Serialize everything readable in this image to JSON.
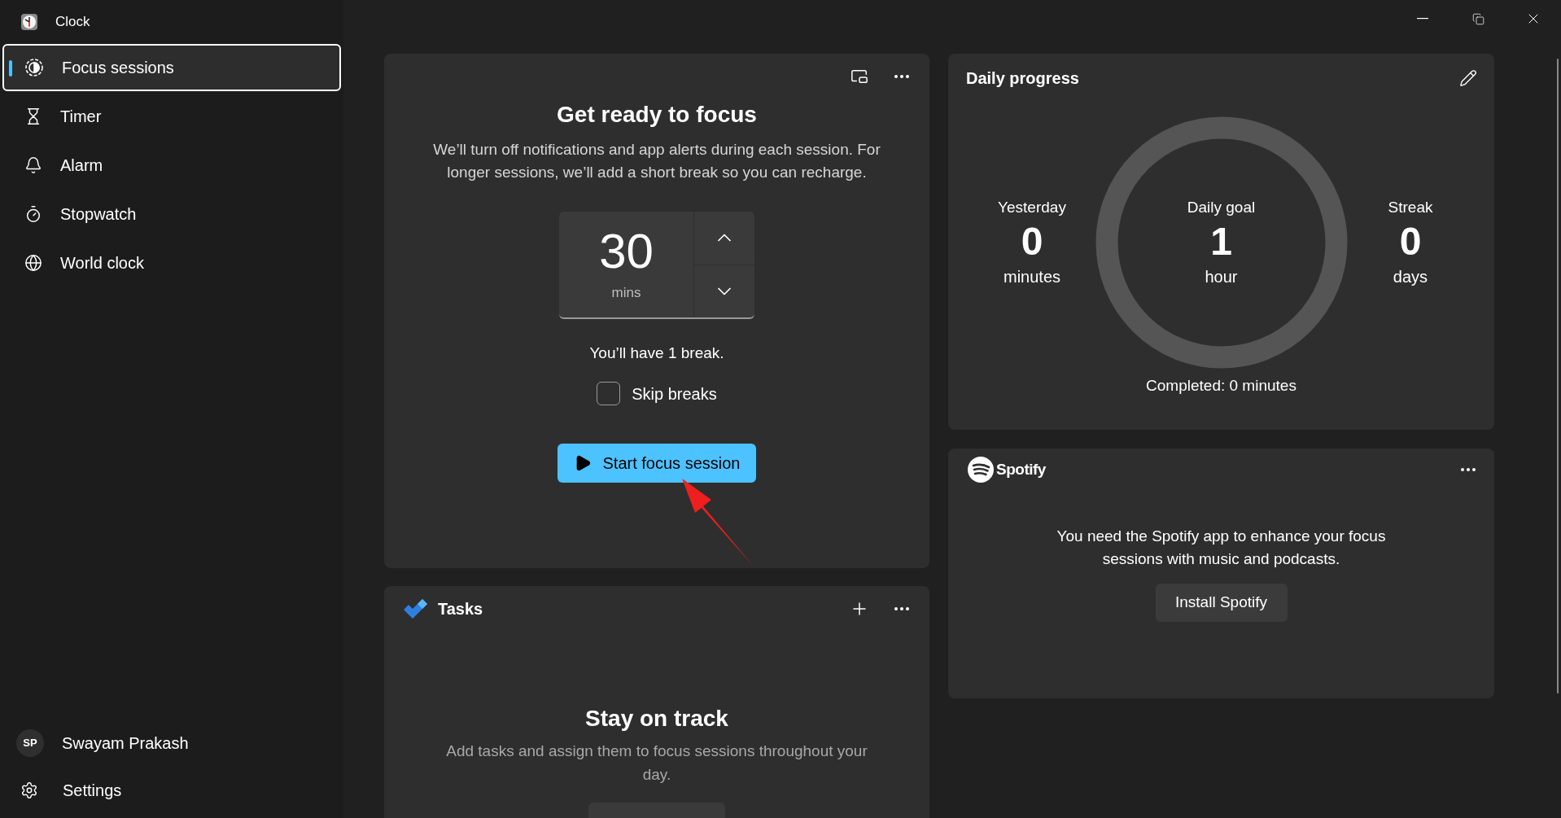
{
  "app": {
    "title": "Clock"
  },
  "nav": [
    {
      "label": "Focus sessions",
      "selected": true
    },
    {
      "label": "Timer",
      "selected": false
    },
    {
      "label": "Alarm",
      "selected": false
    },
    {
      "label": "Stopwatch",
      "selected": false
    },
    {
      "label": "World clock",
      "selected": false
    }
  ],
  "account": {
    "initials": "SP",
    "name": "Swayam Prakash"
  },
  "settings": {
    "label": "Settings"
  },
  "focus": {
    "title": "Get ready to focus",
    "description": "We’ll turn off notifications and app alerts during each session. For longer sessions, we’ll add a short break so you can recharge.",
    "duration": "30",
    "unit": "mins",
    "breaks": "You’ll have 1 break.",
    "skip_breaks": {
      "label": "Skip breaks",
      "checked": false
    },
    "start_button": "Start focus session"
  },
  "tasks": {
    "title": "Tasks",
    "empty_title": "Stay on track",
    "empty_text": "Add tasks and assign them to focus sessions throughout your day."
  },
  "daily_progress": {
    "title": "Daily progress",
    "stats": [
      {
        "kind": "stat",
        "label": "Yesterday",
        "value": "0",
        "unit": "minutes"
      },
      {
        "kind": "goal",
        "label": "Daily goal",
        "value": "1",
        "unit": "hour"
      },
      {
        "kind": "stat",
        "label": "Streak",
        "value": "0",
        "unit": "days"
      }
    ],
    "completed": "Completed: 0 minutes"
  },
  "spotify": {
    "brand": "Spotify",
    "message": "You need the Spotify app to enhance your focus sessions with music and podcasts.",
    "button": "Install Spotify"
  }
}
